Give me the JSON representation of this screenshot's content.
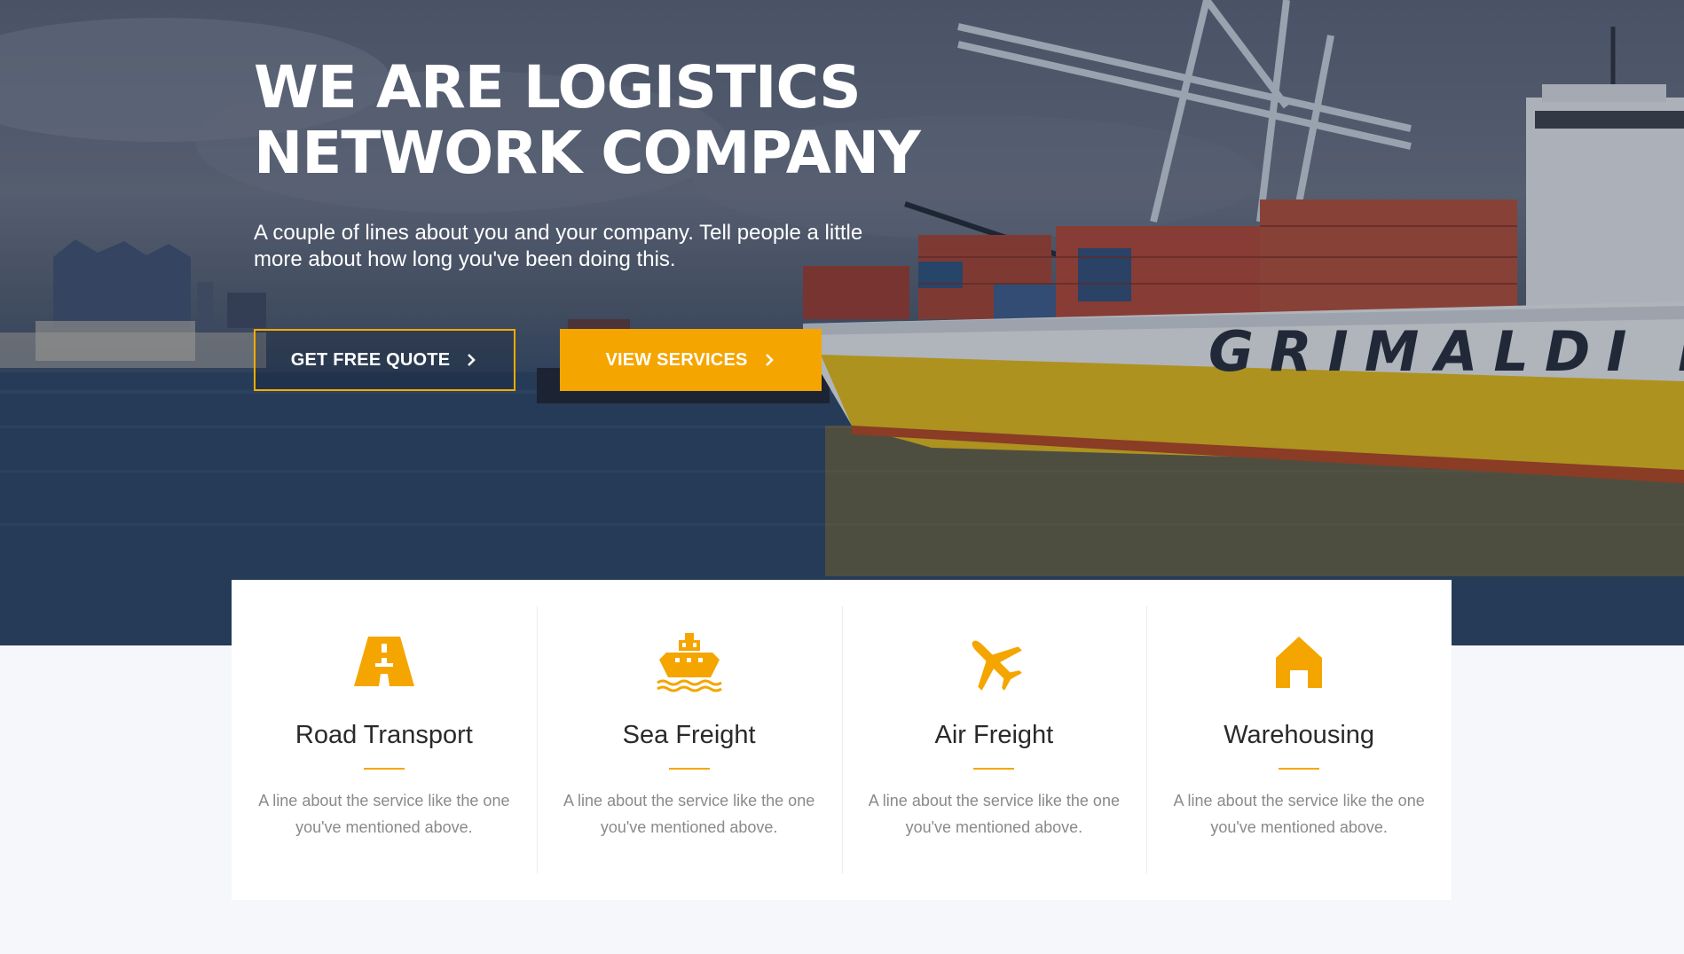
{
  "hero": {
    "title_line1": "WE ARE LOGISTICS",
    "title_line2": "NETWORK COMPANY",
    "description": "A couple of lines about you and your company. Tell people a little more about how long you've been doing this.",
    "ship_name": "GRIMALDI LI",
    "primary_button": {
      "label": "GET FREE QUOTE",
      "icon": "chevron-right-icon"
    },
    "secondary_button": {
      "label": "VIEW SERVICES",
      "icon": "chevron-right-icon"
    }
  },
  "services": [
    {
      "title": "Road Transport",
      "description": "A line about the service like the one you've mentioned above.",
      "icon": "road-icon"
    },
    {
      "title": "Sea Freight",
      "description": "A line about the service like the one you've mentioned above.",
      "icon": "ship-icon"
    },
    {
      "title": "Air Freight",
      "description": "A line about the service like the one you've mentioned above.",
      "icon": "airplane-icon"
    },
    {
      "title": "Warehousing",
      "description": "A line about the service like the one you've mentioned above.",
      "icon": "warehouse-icon"
    }
  ],
  "colors": {
    "accent": "#f5a500",
    "background": "#f5f7fa",
    "card": "#ffffff",
    "text_dark": "#2a2a2a",
    "text_muted": "#8a8a8a"
  }
}
